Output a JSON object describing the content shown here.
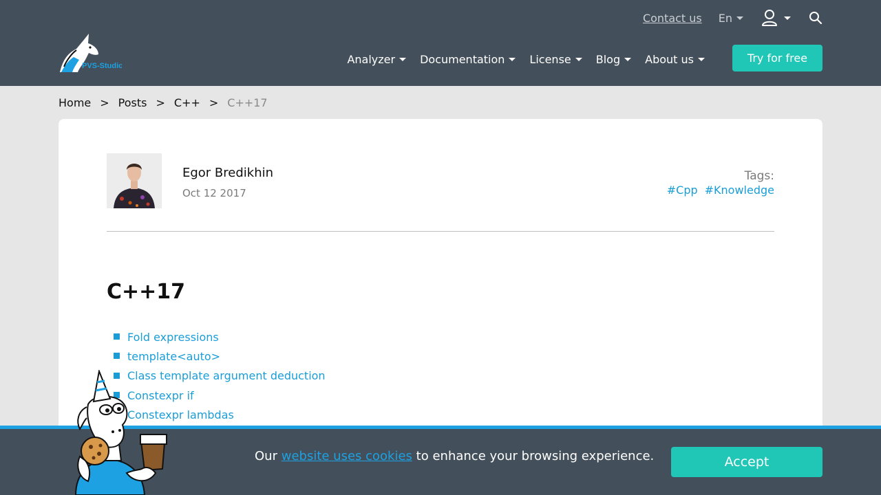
{
  "header": {
    "contact_label": "Contact us",
    "language": "En",
    "nav": [
      {
        "label": "Analyzer"
      },
      {
        "label": "Documentation"
      },
      {
        "label": "License"
      },
      {
        "label": "Blog"
      },
      {
        "label": "About us"
      }
    ],
    "cta_label": "Try for free",
    "logo_text": "PVS-Studio"
  },
  "breadcrumb": [
    "Home",
    "Posts",
    "C++",
    "C++17"
  ],
  "author": {
    "name": "Egor Bredikhin",
    "date": "Oct 12 2017"
  },
  "tags": {
    "label": "Tags:",
    "items": [
      "#Cpp",
      "#Knowledge"
    ]
  },
  "post": {
    "title": "C++17",
    "toc": [
      "Fold expressions",
      "template<auto>",
      "Class template argument deduction",
      "Constexpr if",
      "Constexpr lambdas"
    ]
  },
  "cookie": {
    "prefix": "Our",
    "link_text": "website uses cookies",
    "suffix": "to enhance your browsing experience.",
    "accept_label": "Accept"
  },
  "colors": {
    "header_bg": "#434f5a",
    "accent_teal": "#20c6b6",
    "link_blue": "#1a9dd6"
  }
}
